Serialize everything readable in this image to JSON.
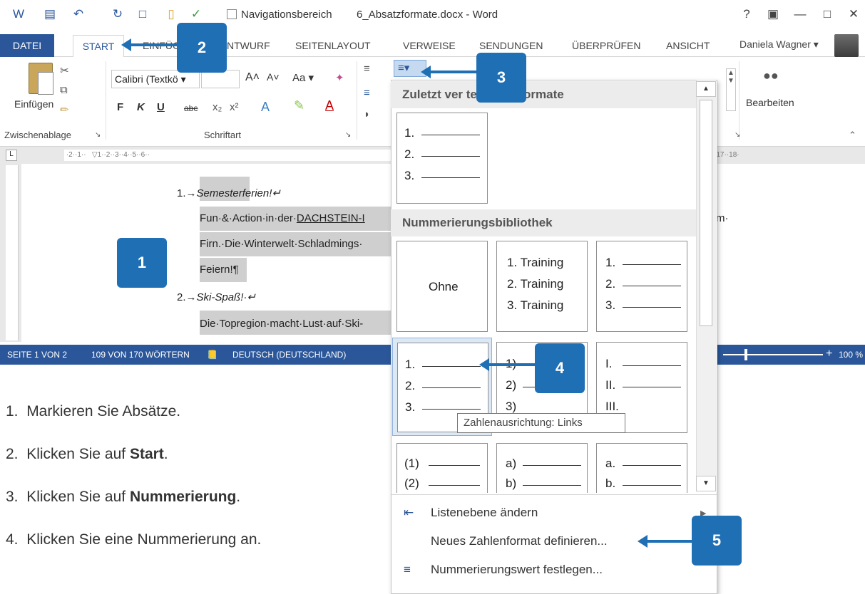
{
  "window": {
    "nav_label": "Navigationsbereich",
    "title": "6_Absatzformate.docx - Word",
    "help": "?",
    "restore": "▣",
    "minimize": "—",
    "maximize": "□",
    "close": "✕"
  },
  "tabs": {
    "datei": "DATEI",
    "start": "START",
    "einfuegen": "EINFÜG",
    "entwurf": "NTWURF",
    "seitenlayout": "SEITENLAYOUT",
    "verweise": "VERWEISE",
    "sendungen": "SENDUNGEN",
    "ueberpruefen": "ÜBERPRÜFEN",
    "ansicht": "ANSICHT"
  },
  "user": {
    "name": "Daniela Wagner ▾"
  },
  "ribbon": {
    "paste_label": "Einfügen",
    "group_clipboard": "Zwischenablage",
    "group_font": "Schriftart",
    "font_name": "Calibri (Textkö ▾",
    "font_size": "",
    "bold": "F",
    "italic": "K",
    "underline": "U",
    "strike": "abc",
    "grow": "A˄",
    "shrink": "A˅",
    "case": "Aa ▾",
    "edit_label": "Bearbeiten"
  },
  "document": {
    "line1_num": "1.→",
    "line1": "Semesterferien!↵",
    "line2_pre": "Fun·&·Action·in·der·",
    "line2_link": "DACHSTEIN-I",
    "line2_right": "m·",
    "line3": "Firn.·Die·Winterwelt·Schladmings·",
    "line4": "Feiern!¶",
    "line5_num": "2.→",
    "line5": "Ski-Spaß!·↵",
    "line6": "Die·Topregion·macht·Lust·auf·Ski-"
  },
  "status": {
    "page": "SEITE 1 VON 2",
    "words": "109 VON 170 WÖRTERN",
    "lang": "DEUTSCH (DEUTSCHLAND)",
    "zoom": "100 %"
  },
  "dropdown": {
    "recent_header": "Zuletzt ver       te Zahlenformate",
    "library_header": "Nummerierungsbibliothek",
    "none_label": "Ohne",
    "recent_tile": [
      "1.",
      "2.",
      "3."
    ],
    "training_tile": [
      "1. Training",
      "2. Training",
      "3. Training"
    ],
    "decimal_tile": [
      "1.",
      "2.",
      "3."
    ],
    "left_tile": [
      "1.",
      "2.",
      "3."
    ],
    "paren_tile": [
      "1)",
      "2)",
      "3)"
    ],
    "roman_tile": [
      "I.",
      "II.",
      "III."
    ],
    "paren2_tile": [
      "(1)",
      "(2)"
    ],
    "alpha_tile": [
      "a)",
      "b)"
    ],
    "alpha2_tile": [
      "a.",
      "b."
    ],
    "tooltip": "Zahlenausrichtung: Links",
    "menu": [
      "Listenebene ändern",
      "Neues Zahlenformat definieren...",
      "Nummerierungswert festlegen..."
    ]
  },
  "callouts": [
    "1",
    "2",
    "3",
    "4",
    "5"
  ],
  "steps": [
    {
      "num": "1.",
      "text": "Markieren Sie Absätze.",
      "bold": "",
      "tail": ""
    },
    {
      "num": "2.",
      "text": "Klicken Sie auf ",
      "bold": "Start",
      "tail": "."
    },
    {
      "num": "3.",
      "text": "Klicken Sie auf ",
      "bold": "Nummerierung",
      "tail": "."
    },
    {
      "num": "4.",
      "text": "Klicken Sie eine Nummerierung an.",
      "bold": "",
      "tail": ""
    }
  ],
  "colors": {
    "accent": "#2b579a",
    "callout": "#1f6fb5"
  }
}
